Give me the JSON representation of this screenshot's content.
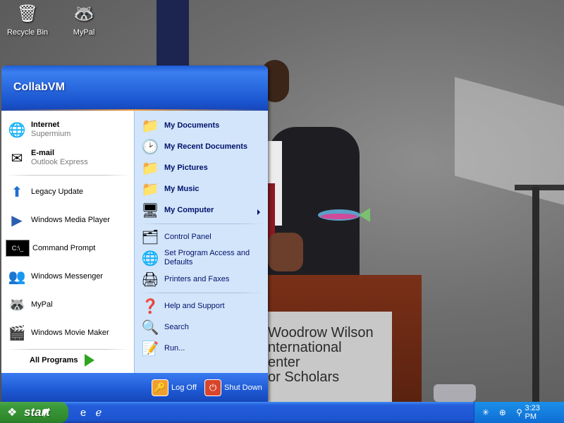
{
  "desktop": {
    "icons": [
      {
        "name": "recycle-bin",
        "label": "Recycle Bin"
      },
      {
        "name": "mypal",
        "label": "MyPal"
      }
    ],
    "background_sign": [
      "Woodrow Wilson",
      "nternational",
      "enter",
      "or Scholars"
    ]
  },
  "start_menu": {
    "user": "CollabVM",
    "pinned": [
      {
        "label": "Internet",
        "sub": "Supermium"
      },
      {
        "label": "E-mail",
        "sub": "Outlook Express"
      }
    ],
    "recent": [
      "Legacy Update",
      "Windows Media Player",
      "Command Prompt",
      "Windows Messenger",
      "MyPal",
      "Windows Movie Maker"
    ],
    "all_programs": "All Programs",
    "places": [
      "My Documents",
      "My Recent Documents",
      "My Pictures",
      "My Music",
      "My Computer"
    ],
    "system": [
      "Control Panel",
      "Set Program Access and Defaults",
      "Printers and Faxes"
    ],
    "tools": [
      "Help and Support",
      "Search",
      "Run..."
    ],
    "log_off": "Log Off",
    "shut_down": "Shut Down"
  },
  "taskbar": {
    "start_label": "start",
    "clock": "3:23 PM"
  },
  "colors": {
    "header_blue": "#1f5ed6",
    "right_panel": "#d3e5fa",
    "start_green": "#3c9a3b",
    "tray_blue": "#0f6dd4"
  }
}
